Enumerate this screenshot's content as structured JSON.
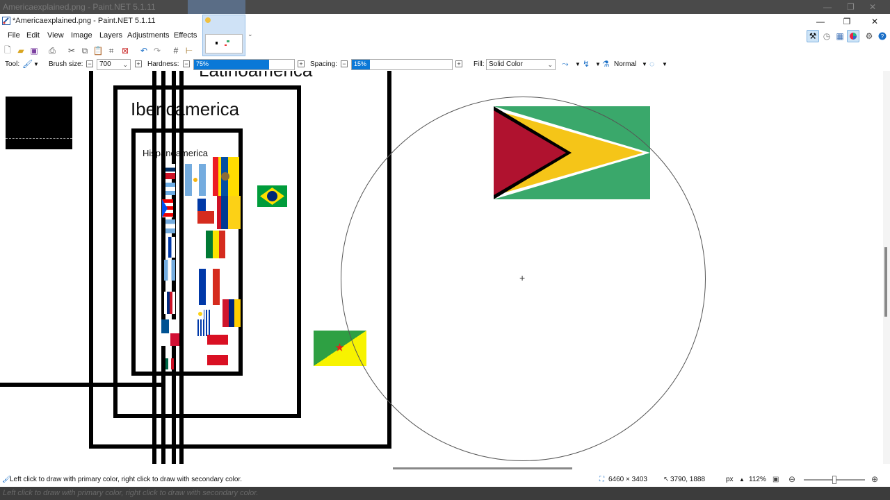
{
  "window": {
    "title": "*Americaexplained.png - Paint.NET 5.1.11",
    "ghost_title": "Americaexplained.png - Paint.NET 5.1.11"
  },
  "menu": {
    "items": [
      "File",
      "Edit",
      "View",
      "Image",
      "Layers",
      "Adjustments",
      "Effects"
    ]
  },
  "tool_options": {
    "tool_label": "Tool:",
    "brush_size_label": "Brush size:",
    "brush_size_value": "700",
    "hardness_label": "Hardness:",
    "hardness_value": "75%",
    "hardness_fraction": 0.75,
    "spacing_label": "Spacing:",
    "spacing_value": "15%",
    "spacing_fraction": 0.15,
    "fill_label": "Fill:",
    "fill_value": "Solid Color",
    "blend_mode": "Normal"
  },
  "canvas": {
    "labels": {
      "latinoamerica": "Latinoamerica",
      "ibericamerica": "Ibericamerica",
      "hispanoamerica": "Hispanoamerica"
    },
    "brush_cursor": "+"
  },
  "status": {
    "hint": "Left click to draw with primary color, right click to draw with secondary color.",
    "image_size": "6460 × 3403",
    "cursor_pos": "3790, 1888",
    "units": "px",
    "zoom": "112%"
  },
  "icons": {
    "app": "paintnet-icon",
    "tools_window": "tools-icon",
    "history_window": "history-icon",
    "layers_window": "layers-icon",
    "colors_window": "colors-icon",
    "settings": "gear-icon",
    "help": "help-icon"
  },
  "colors": {
    "accent": "#0a78d7",
    "guyana_green": "#3aa86b",
    "guyana_yellow": "#f5c518",
    "guyana_red": "#b0122f",
    "fr_guiana_yellow": "#f7f300",
    "fr_guiana_green": "#2ea043"
  }
}
